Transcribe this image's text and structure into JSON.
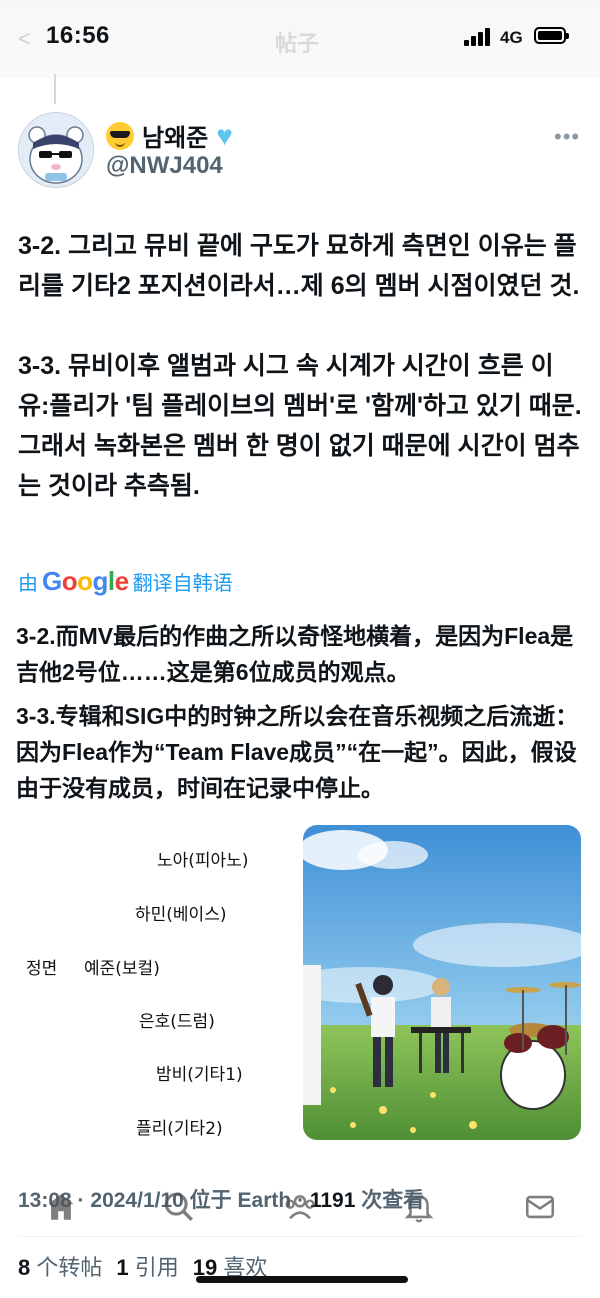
{
  "status_bar": {
    "time": "16:56",
    "network": "4G",
    "faded_header": "帖子"
  },
  "author": {
    "display_name": "남왜준",
    "handle": "@NWJ404"
  },
  "tweet": {
    "korean": [
      {
        "num": "3-2.",
        "text": " 그리고 뮤비 끝에 구도가 묘하게 측면인 이유는 플리를 기타2 포지션이라서…제 6의 멤버 시점이였던 것."
      },
      {
        "num": "3-3.",
        "text": " 뮤비이후 앨범과 시그 속 시계가 시간이 흐른 이유:플리가 '팀 플레이브의 멤버'로 '함께'하고 있기 때문. 그래서 녹화본은 멤버 한 명이 없기 때문에 시간이 멈추는 것이라 추측됨."
      }
    ],
    "translation_label_prefix": "由",
    "translation_brand": "Google",
    "translation_label_suffix": "翻译自韩语",
    "chinese": [
      "3-2.而MV最后的作曲之所以奇怪地横着，是因为Flea是吉他2号位……这是第6位成员的观点。",
      "3-3.专辑和SIG中的时钟之所以会在音乐视频之后流逝：因为Flea作为“Team Flave成员”“在一起”。因此，假设由于没有成员，时间在记录中停止。"
    ]
  },
  "diagram": {
    "front": "정면",
    "labels": [
      "노아(피아노)",
      "하민(베이스)",
      "예준(보컬)",
      "은호(드럼)",
      "밤비(기타1)",
      "플리(기타2)"
    ]
  },
  "meta": {
    "time": "13:08",
    "date": "2024/1/10",
    "location": "位于 Earth",
    "views": "1191",
    "views_label": "次查看"
  },
  "stats": {
    "retweets": "8",
    "retweets_label": "个转帖",
    "quotes": "1",
    "quotes_label": "引用",
    "likes": "19",
    "likes_label": "喜欢"
  },
  "icons": [
    "home-icon",
    "search-icon",
    "communities-icon",
    "notifications-icon",
    "messages-icon",
    "more-icon"
  ]
}
